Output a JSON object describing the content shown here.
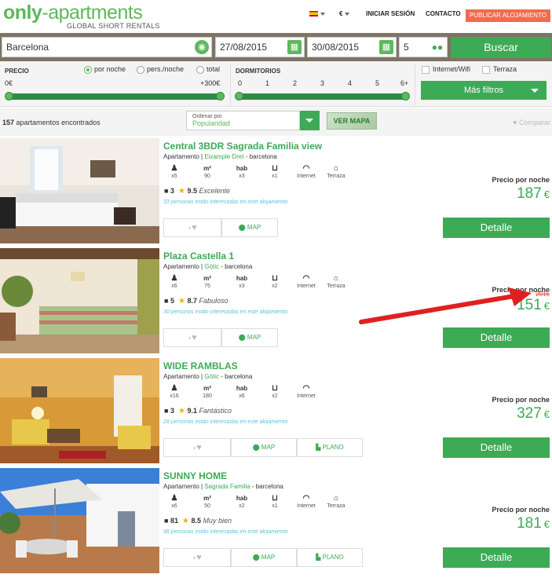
{
  "header": {
    "logo_bold": "only",
    "logo_rest": "-apartments",
    "tagline": "GLOBAL SHORT RENTALS",
    "currency": "€",
    "login": "INICIAR SESIÓN",
    "contact": "CONTACTO",
    "publish": "PUBLICAR ALOJAMIENTO"
  },
  "search": {
    "city": "Barcelona",
    "checkin": "27/08/2015",
    "checkout": "30/08/2015",
    "guests": "5",
    "button": "Buscar"
  },
  "filters": {
    "price_label": "PRECIO",
    "radio_night": "por noche",
    "radio_person": "pers./noche",
    "radio_total": "total",
    "price_min": "0€",
    "price_max": "+300€",
    "rooms_label": "DORMITORIOS",
    "room_ticks": [
      "0",
      "1",
      "2",
      "3",
      "4",
      "5",
      "6+"
    ],
    "wifi": "Internet/Wifi",
    "terrace": "Terraza",
    "more": "Más filtros"
  },
  "results": {
    "count": "157",
    "count_text": "apartamentos encontrados",
    "order_label": "Ordenar por",
    "order_value": "Popularidad",
    "map": "VER MAPA",
    "compare": "Comparar"
  },
  "labels": {
    "per_night": "Precio por noche",
    "detail": "Detalle",
    "map": "MAP",
    "plan": "PLANO",
    "type": "Apartamento",
    "city": "barcelona",
    "currency": "€"
  },
  "listings": [
    {
      "title": "Central 3BDR Sagrada Familia view",
      "zone": "Eixample Dret",
      "amenities": [
        {
          "icon": "person-icon",
          "value": "x5"
        },
        {
          "icon": "m2-icon",
          "value": "90"
        },
        {
          "icon": "hab-icon",
          "value": "x3"
        },
        {
          "icon": "bathtub-icon",
          "value": "x1"
        },
        {
          "icon": "wifi-icon",
          "value": "Internet"
        },
        {
          "icon": "terrace-icon",
          "value": "Terraza"
        }
      ],
      "reviews": "3",
      "rating": "9.5",
      "rating_text": "Excelente",
      "interest": "33 personas están interesadas en este alojamiento",
      "price": "187",
      "old_price": ""
    },
    {
      "title": "Plaza Castella 1",
      "zone": "Gòtic",
      "amenities": [
        {
          "icon": "person-icon",
          "value": "x6"
        },
        {
          "icon": "m2-icon",
          "value": "75"
        },
        {
          "icon": "hab-icon",
          "value": "x3"
        },
        {
          "icon": "bathtub-icon",
          "value": "x2"
        },
        {
          "icon": "wifi-icon",
          "value": "Internet"
        },
        {
          "icon": "terrace-icon",
          "value": "Terraza"
        }
      ],
      "reviews": "5",
      "rating": "8.7",
      "rating_text": "Fabuloso",
      "interest": "30 personas están interesadas en este alojamiento",
      "price": "151",
      "old_price": "201€"
    },
    {
      "title": "WIDE RAMBLAS",
      "zone": "Gòtic",
      "amenities": [
        {
          "icon": "person-icon",
          "value": "x16"
        },
        {
          "icon": "m2-icon",
          "value": "180"
        },
        {
          "icon": "hab-icon",
          "value": "x6"
        },
        {
          "icon": "bathtub-icon",
          "value": "x2"
        },
        {
          "icon": "wifi-icon",
          "value": "Internet"
        }
      ],
      "reviews": "3",
      "rating": "9.1",
      "rating_text": "Fantástico",
      "interest": "28 personas están interesadas en este alojamiento",
      "price": "327",
      "old_price": ""
    },
    {
      "title": "SUNNY HOME",
      "zone": "Sagrada Familia",
      "amenities": [
        {
          "icon": "person-icon",
          "value": "x6"
        },
        {
          "icon": "m2-icon",
          "value": "50"
        },
        {
          "icon": "hab-icon",
          "value": "x2"
        },
        {
          "icon": "bathtub-icon",
          "value": "x1"
        },
        {
          "icon": "wifi-icon",
          "value": "Internet"
        },
        {
          "icon": "terrace-icon",
          "value": "Terraza"
        }
      ],
      "reviews": "81",
      "rating": "8.5",
      "rating_text": "Muy bien",
      "interest": "96 personas están interesadas en este alojamiento",
      "price": "181",
      "old_price": ""
    }
  ],
  "colors": {
    "accent": "#3daa56",
    "publish": "#f26b4e",
    "arrow": "#e02020"
  }
}
